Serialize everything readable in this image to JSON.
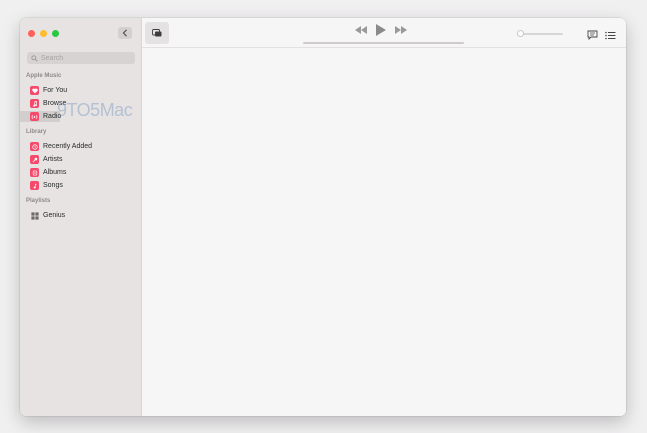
{
  "search": {
    "placeholder": "Search"
  },
  "sidebar": {
    "apple_music_label": "Apple Music",
    "apple_music_items": [
      {
        "label": "For You",
        "icon": "heart-icon"
      },
      {
        "label": "Browse",
        "icon": "music-note-icon"
      },
      {
        "label": "Radio",
        "icon": "radio-icon"
      }
    ],
    "library_label": "Library",
    "library_items": [
      {
        "label": "Recently Added",
        "icon": "clock-icon"
      },
      {
        "label": "Artists",
        "icon": "microphone-icon"
      },
      {
        "label": "Albums",
        "icon": "album-icon"
      },
      {
        "label": "Songs",
        "icon": "music-note-icon"
      }
    ],
    "playlists_label": "Playlists",
    "playlist_items": [
      {
        "label": "Genius",
        "icon": "genius-grid-icon"
      }
    ],
    "selected": "Radio"
  },
  "watermark": "9TO5Mac",
  "colors": {
    "accent": "#f54a6b",
    "close": "#fe5f57",
    "minimize": "#febc2e",
    "zoom": "#28c840"
  }
}
